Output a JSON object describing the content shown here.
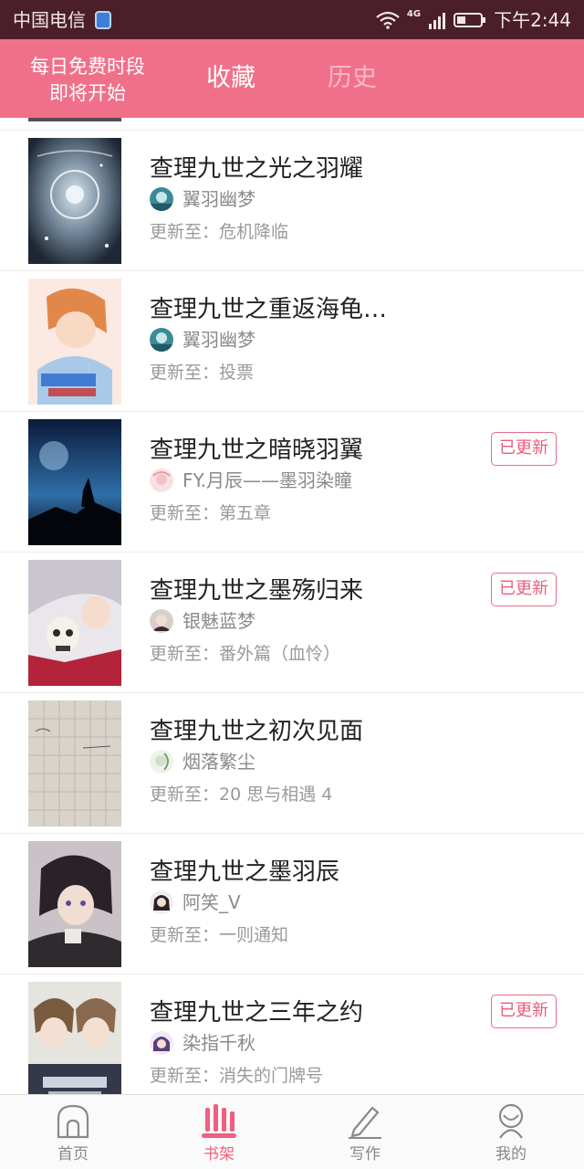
{
  "status_bar": {
    "carrier": "中国电信",
    "network": "4G",
    "time": "下午2:44"
  },
  "header": {
    "promo_line1": "每日免费时段",
    "promo_line2": "即将开始",
    "tab_favorites": "收藏",
    "tab_history": "历史"
  },
  "colors": {
    "accent": "#f0708a",
    "status_bar": "#4a1f2a",
    "badge": "#ea5c7d"
  },
  "books": [
    {
      "title": "查理九世之光之羽耀",
      "author": "翼羽幽梦",
      "update_prefix": "更新至：",
      "update": "危机降临",
      "updated_badge": ""
    },
    {
      "title": "查理九世之重返海龟…",
      "author": "翼羽幽梦",
      "update_prefix": "更新至：",
      "update": "投票",
      "updated_badge": ""
    },
    {
      "title": "查理九世之暗晓羽翼",
      "author": "FY.月辰——墨羽染瞳",
      "update_prefix": "更新至：",
      "update": "第五章",
      "updated_badge": "已更新"
    },
    {
      "title": "查理九世之墨殇归来",
      "author": "银魅蓝梦",
      "update_prefix": "更新至：",
      "update": "番外篇（血怜）",
      "updated_badge": "已更新"
    },
    {
      "title": "查理九世之初次见面",
      "author": "烟落繁尘",
      "update_prefix": "更新至：",
      "update": "20  思与相遇  4",
      "updated_badge": ""
    },
    {
      "title": "查理九世之墨羽辰",
      "author": "阿笑_V",
      "update_prefix": "更新至：",
      "update": "一则通知",
      "updated_badge": ""
    },
    {
      "title": "查理九世之三年之约",
      "author": "染指千秋",
      "update_prefix": "更新至：",
      "update": "消失的门牌号",
      "updated_badge": "已更新"
    }
  ],
  "bottom_nav": [
    {
      "label": "首页",
      "icon": "home-icon",
      "active": false
    },
    {
      "label": "书架",
      "icon": "bookshelf-icon",
      "active": true
    },
    {
      "label": "写作",
      "icon": "pen-icon",
      "active": false
    },
    {
      "label": "我的",
      "icon": "profile-icon",
      "active": false
    }
  ]
}
